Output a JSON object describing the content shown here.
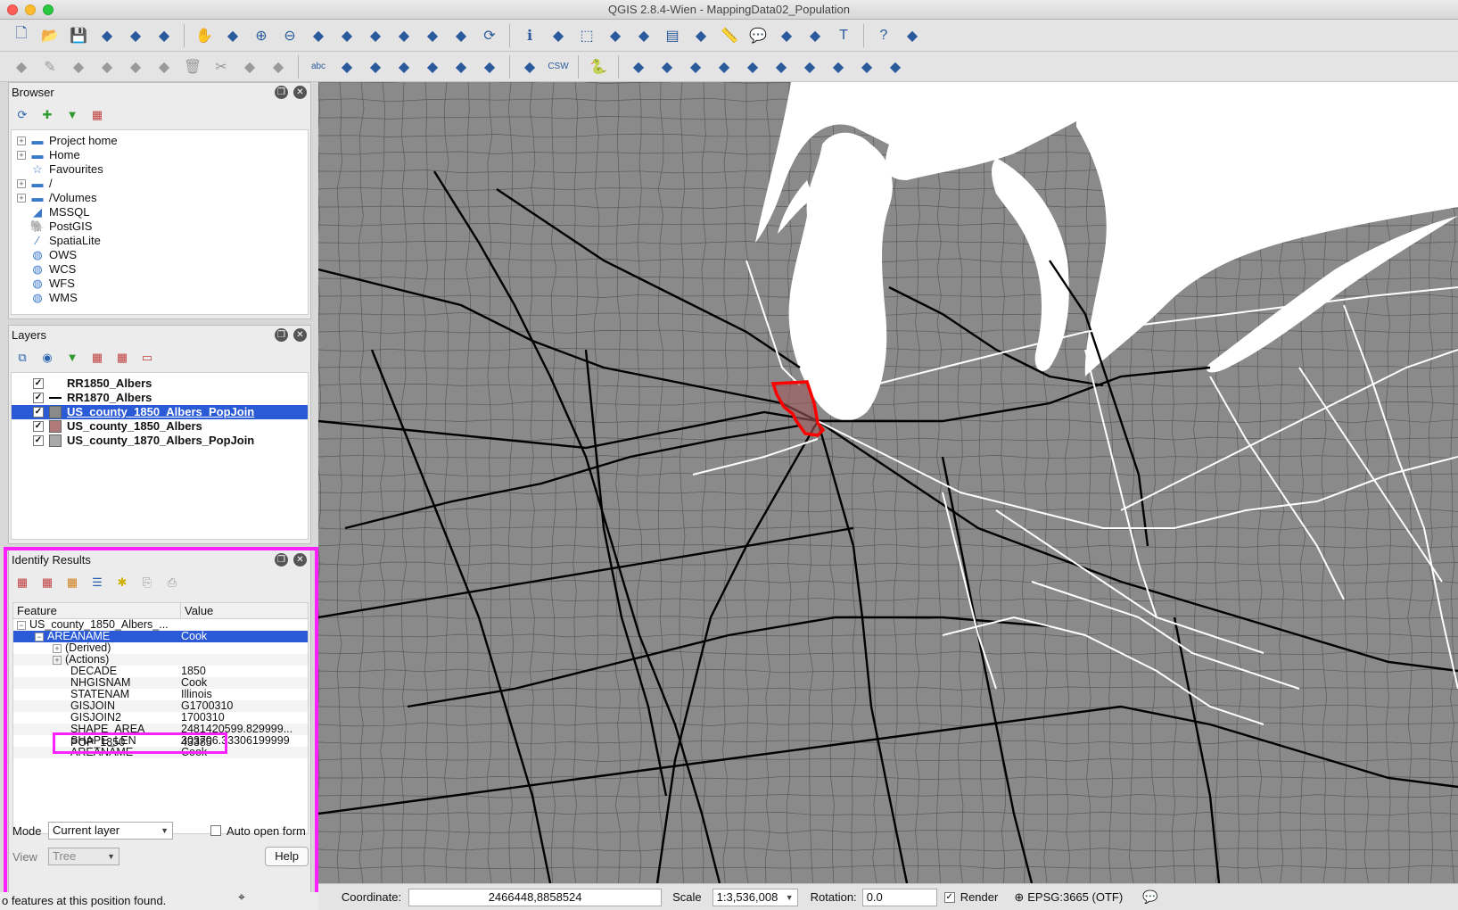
{
  "window": {
    "title": "QGIS 2.8.4-Wien - MappingData02_Population"
  },
  "toolbar1": {
    "icons": [
      "new-project-icon",
      "open-project-icon",
      "save-project-icon",
      "save-as-icon",
      "new-print-composer-icon",
      "composer-manager-icon",
      "pan-icon",
      "pan-to-selection-icon",
      "zoom-in-icon",
      "zoom-out-icon",
      "zoom-native-icon",
      "zoom-full-icon",
      "zoom-to-selection-icon",
      "zoom-to-layer-icon",
      "zoom-last-icon",
      "zoom-next-icon",
      "refresh-icon",
      "identify-icon",
      "action-icon",
      "select-icon",
      "deselect-icon",
      "expression-select-icon",
      "open-attribute-table-icon",
      "statistics-icon",
      "measure-icon",
      "annotation-icon",
      "new-bookmark-icon",
      "show-bookmarks-icon",
      "text-annotation-icon",
      "help-icon",
      "whats-this-icon"
    ]
  },
  "toolbar2": {
    "icons": [
      "toggle-editing-icon",
      "edit-pencil-icon",
      "save-edits-icon",
      "add-feature-icon",
      "move-feature-icon",
      "node-tool-icon",
      "delete-selected-icon",
      "cut-icon",
      "copy-icon",
      "paste-icon",
      "label-icon",
      "label-pin-icon",
      "label-show-icon",
      "label-move-icon",
      "label-rotate-icon",
      "label-change-icon",
      "label-pinned-icon",
      "db-manager-icon",
      "csw-icon",
      "python-icon",
      "add-vector-icon",
      "add-raster-icon",
      "add-postgis-icon",
      "add-spatialite-icon",
      "add-mssql-icon",
      "add-wms-icon",
      "add-wcs-icon",
      "add-wfs-icon",
      "add-delimited-icon",
      "new-shapefile-icon"
    ]
  },
  "browser": {
    "title": "Browser",
    "items": [
      {
        "label": "Project home",
        "icon": "folder-icon",
        "expandable": true
      },
      {
        "label": "Home",
        "icon": "folder-icon",
        "expandable": true
      },
      {
        "label": "Favourites",
        "icon": "star-icon",
        "expandable": false
      },
      {
        "label": "/",
        "icon": "folder-icon",
        "expandable": true
      },
      {
        "label": "/Volumes",
        "icon": "folder-icon",
        "expandable": true
      },
      {
        "label": "MSSQL",
        "icon": "mssql-icon",
        "expandable": false
      },
      {
        "label": "PostGIS",
        "icon": "postgis-icon",
        "expandable": false
      },
      {
        "label": "SpatiaLite",
        "icon": "spatialite-icon",
        "expandable": false
      },
      {
        "label": "OWS",
        "icon": "ows-icon",
        "expandable": false
      },
      {
        "label": "WCS",
        "icon": "wcs-icon",
        "expandable": false
      },
      {
        "label": "WFS",
        "icon": "wfs-icon",
        "expandable": false
      },
      {
        "label": "WMS",
        "icon": "wms-icon",
        "expandable": false
      }
    ]
  },
  "layers": {
    "title": "Layers",
    "items": [
      {
        "label": "RR1850_Albers",
        "symbol": "none",
        "checked": true
      },
      {
        "label": "RR1870_Albers",
        "symbol": "line",
        "color": "#000000",
        "checked": true
      },
      {
        "label": "US_county_1850_Albers_PopJoin",
        "symbol": "fill",
        "color": "#8a8a8a",
        "checked": true,
        "selected": true
      },
      {
        "label": "US_county_1850_Albers",
        "symbol": "fill",
        "color": "#b07a7a",
        "checked": true
      },
      {
        "label": "US_county_1870_Albers_PopJoin",
        "symbol": "fill",
        "color": "#a8a8a8",
        "checked": true
      }
    ]
  },
  "identify": {
    "title": "Identify Results",
    "col_feature": "Feature",
    "col_value": "Value",
    "layer": "US_county_1850_Albers_...",
    "selected_attr": "AREANAME",
    "selected_value": "Cook",
    "derived": "(Derived)",
    "actions": "(Actions)",
    "attributes": [
      {
        "name": "DECADE",
        "value": "1850"
      },
      {
        "name": "NHGISNAM",
        "value": "Cook"
      },
      {
        "name": "STATENAM",
        "value": "Illinois"
      },
      {
        "name": "GISJOIN",
        "value": "G1700310"
      },
      {
        "name": "GISJOIN2",
        "value": "1700310"
      },
      {
        "name": "SHAPE_AREA",
        "value": "2481420599.829999..."
      },
      {
        "name": "SHAPE_LEN",
        "value": "303706.33306199999"
      },
      {
        "name": "AREANAME",
        "value": "Cook"
      }
    ],
    "pop_name": "POP_1850",
    "pop_value": "43385",
    "mode_label": "Mode",
    "mode_value": "Current layer",
    "auto_open": "Auto open form",
    "view_label": "View",
    "view_value": "Tree",
    "help": "Help",
    "status": "o features at this position found."
  },
  "status": {
    "coordinate_label": "Coordinate:",
    "coordinate": "2466448,8858524",
    "scale_label": "Scale",
    "scale": "1:3,536,008",
    "rotation_label": "Rotation:",
    "rotation": "0.0",
    "render": "Render",
    "crs": "EPSG:3665 (OTF)"
  },
  "colors": {
    "highlight": "#ff20ff",
    "selection": "#2a5ad6",
    "map_fill": "#8a8a8a",
    "cook_county": "#ff0000"
  }
}
